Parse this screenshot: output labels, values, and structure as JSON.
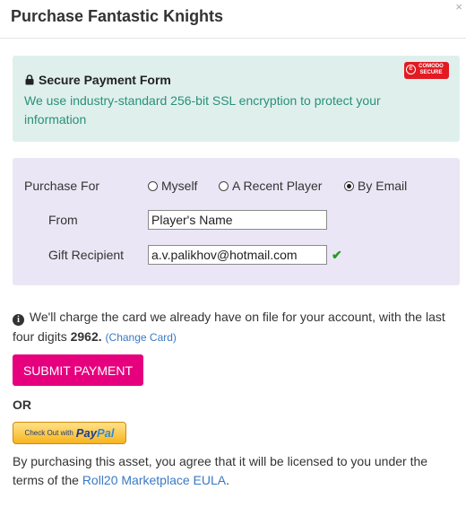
{
  "dialog": {
    "title": "Purchase Fantastic Knights",
    "close_label": "×"
  },
  "secure": {
    "title": "Secure Payment Form",
    "text": "We use industry-standard 256-bit SSL encryption to protect your information",
    "badge_line1": "COMODO",
    "badge_line2": "SECURE",
    "text_color": "#2a8f7a",
    "bg_color": "#dff0ec"
  },
  "form": {
    "purchase_for_label": "Purchase For",
    "options": [
      "Myself",
      "A Recent Player",
      "By Email"
    ],
    "selected_option": "By Email",
    "from_label": "From",
    "from_value": "Player's Name",
    "recipient_label": "Gift Recipient",
    "recipient_value": "a.v.palikhov@hotmail.com",
    "valid_mark": "✔"
  },
  "info": {
    "text_before": " We'll charge the card we already have on file for your account, with the last four digits ",
    "card_digits": "2962.",
    "change_link": "(Change Card)"
  },
  "actions": {
    "submit_label": "SUBMIT PAYMENT",
    "or_label": "OR",
    "paypal_prefix": "Check Out with",
    "paypal_pay": "Pay",
    "paypal_pal": "Pal",
    "submit_color": "#e6007e"
  },
  "footer": {
    "text_before": "By purchasing this asset, you agree that it will be licensed to you under the terms of the ",
    "link": "Roll20 Marketplace EULA",
    "text_after": "."
  }
}
